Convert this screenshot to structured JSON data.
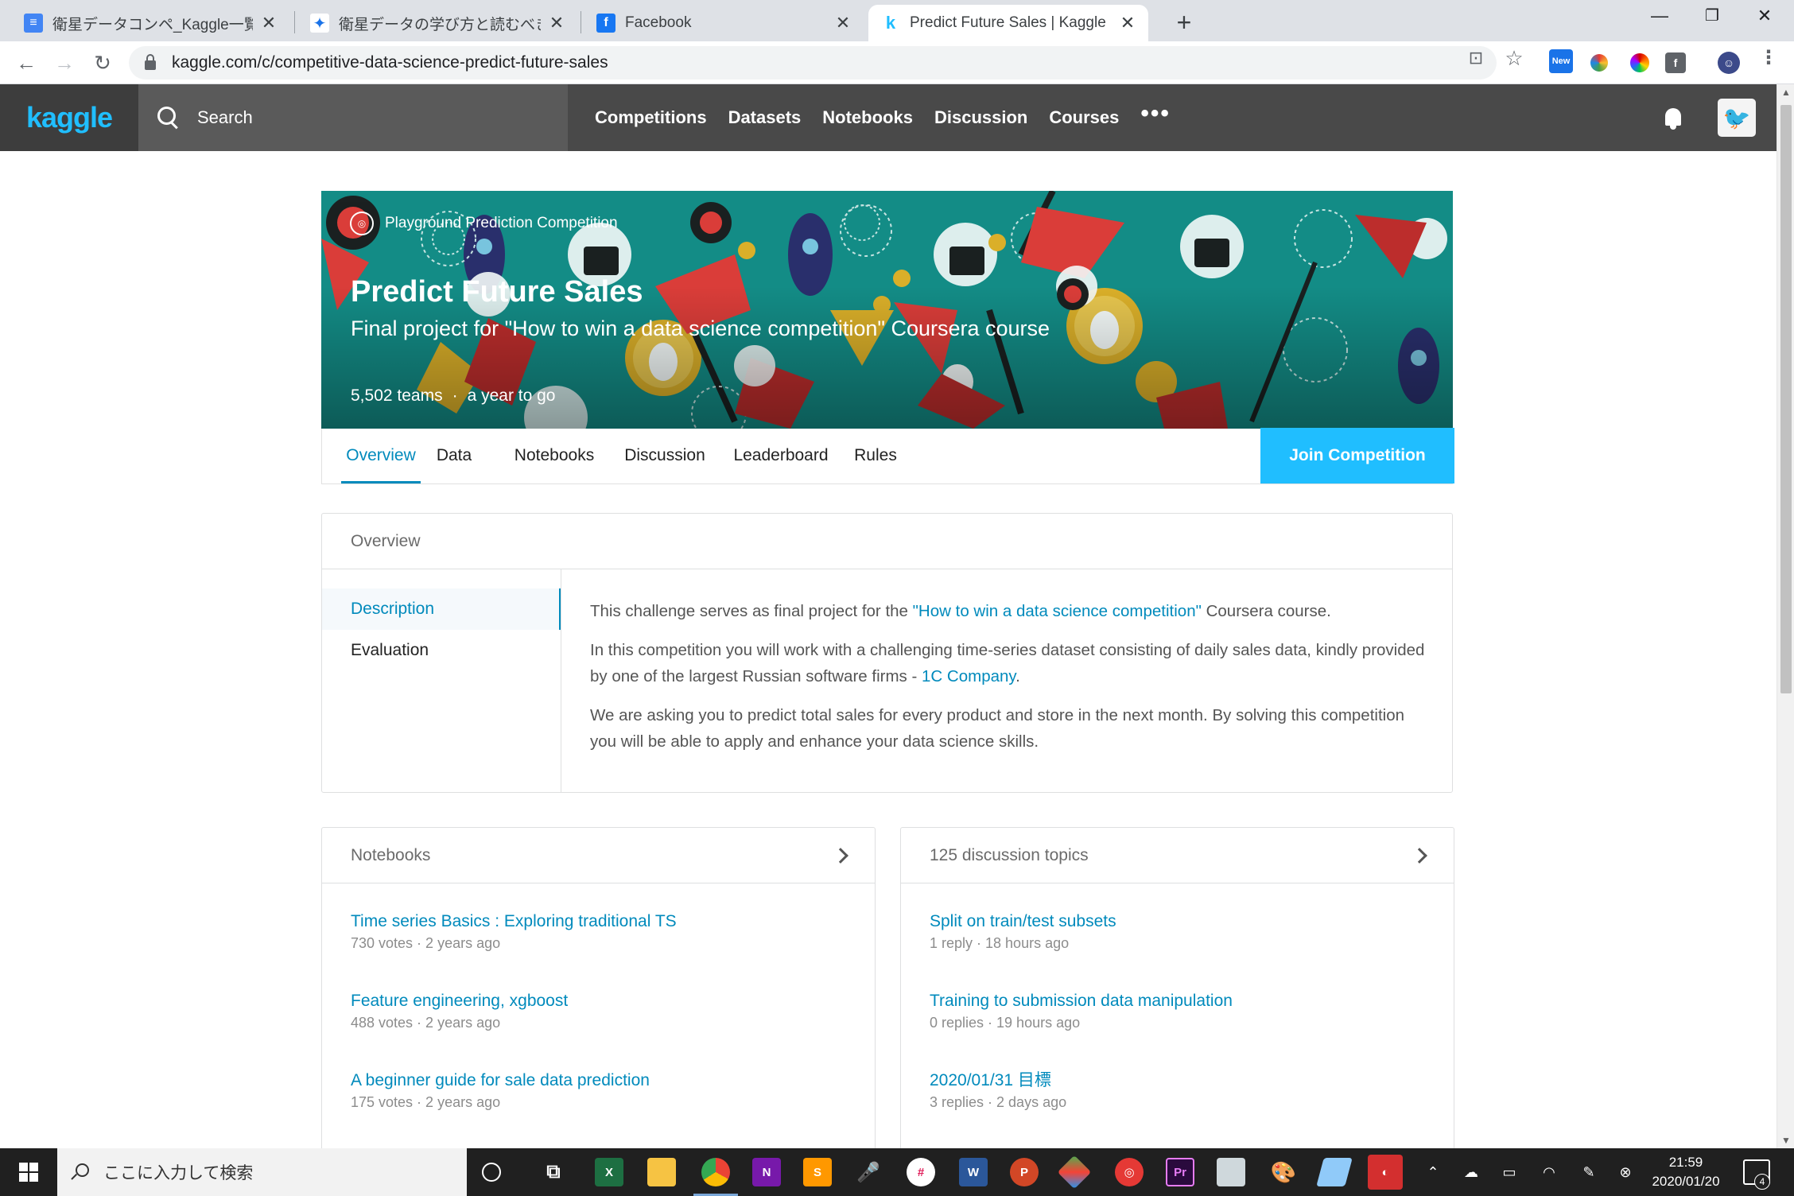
{
  "browser": {
    "tabs": [
      {
        "title": "衛星データコンペ_Kaggle一覧 - Goo",
        "icon": "google-docs-icon",
        "color": "#4285f4",
        "glyph": "≡"
      },
      {
        "title": "衛星データの学び方と読むべき記事を",
        "icon": "sparkle-icon",
        "color": "#ffffff",
        "glyph": "✦"
      },
      {
        "title": "Facebook",
        "icon": "facebook-icon",
        "color": "#1877f2",
        "glyph": "f"
      },
      {
        "title": "Predict Future Sales | Kaggle",
        "icon": "kaggle-icon",
        "color": "#ffffff",
        "glyph": "k"
      }
    ],
    "url": "kaggle.com/c/competitive-data-science-predict-future-sales",
    "extension_new_badge": "New"
  },
  "kaggle": {
    "logo": "kaggle",
    "search_label": "Search",
    "nav": [
      "Competitions",
      "Datasets",
      "Notebooks",
      "Discussion",
      "Courses"
    ],
    "more": "•••"
  },
  "competition": {
    "type": "Playground Prediction Competition",
    "title": "Predict Future Sales",
    "subtitle": "Final project for \"How to win a data science competition\" Coursera course",
    "teams": "5,502 teams",
    "separator": "·",
    "deadline": "a year to go",
    "tabs": [
      "Overview",
      "Data",
      "Notebooks",
      "Discussion",
      "Leaderboard",
      "Rules"
    ],
    "join_label": "Join Competition"
  },
  "overview": {
    "heading": "Overview",
    "side": [
      "Description",
      "Evaluation"
    ],
    "p1_pre": "This challenge serves as final project for the ",
    "p1_link": "\"How to win a data science competition\"",
    "p1_post": " Coursera course.",
    "p2_pre": "In this competition you will work with a challenging time-series dataset consisting of daily sales data, kindly provided by one of the largest Russian software firms - ",
    "p2_link": "1C Company",
    "p2_post": ".",
    "p3": "We are asking you to predict total sales for every product and store in the next month. By solving this competition you will be able to apply and enhance your data science skills."
  },
  "notebooks": {
    "heading": "Notebooks",
    "items": [
      {
        "title": "Time series Basics : Exploring traditional TS",
        "meta": "730 votes · 2 years ago"
      },
      {
        "title": "Feature engineering, xgboost",
        "meta": "488 votes · 2 years ago"
      },
      {
        "title": "A beginner guide for sale data prediction",
        "meta": "175 votes · 2 years ago"
      }
    ]
  },
  "discussion": {
    "heading": "125 discussion topics",
    "items": [
      {
        "title": "Split on train/test subsets",
        "meta": "1 reply · 18 hours ago"
      },
      {
        "title": "Training to submission data manipulation",
        "meta": "0 replies · 19 hours ago"
      },
      {
        "title": "2020/01/31 目標",
        "meta": "3 replies · 2 days ago"
      }
    ]
  },
  "taskbar": {
    "search_placeholder": "ここに入力して検索",
    "time": "21:59",
    "date": "2020/01/20",
    "notification_count": "4"
  }
}
